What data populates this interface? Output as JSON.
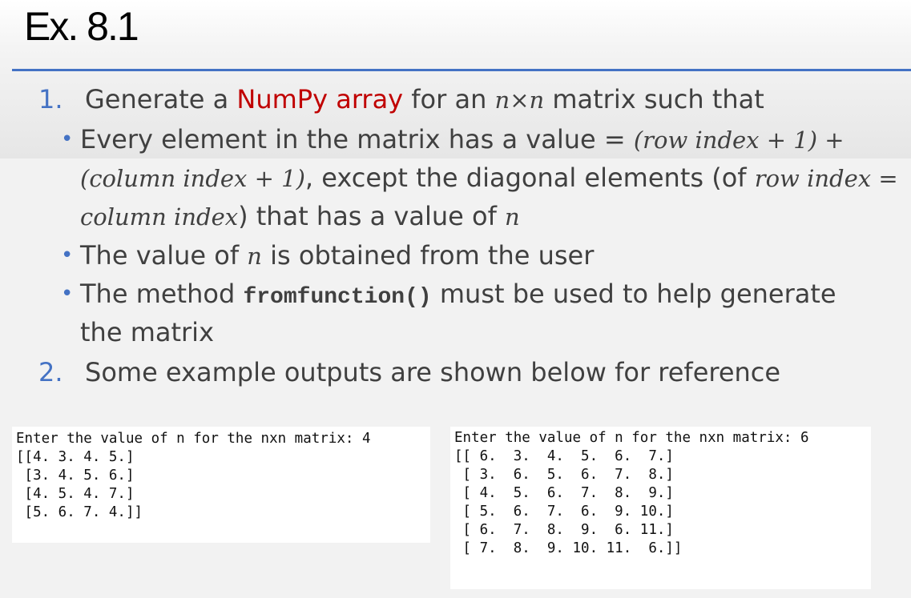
{
  "slide": {
    "title": "Ex. 8.1",
    "item1": {
      "num": "1.",
      "pre": "Generate a ",
      "highlight": "NumPy array",
      "mid": " for an ",
      "math": "n×n",
      "post": " matrix such that"
    },
    "bullet1": {
      "line1_pre": "Every element in the matrix has a value = ",
      "line1_math": "(row index + 1) +",
      "line2_math": "(column index + 1)",
      "line2_post": ", except the diagonal elements (of ",
      "line2_math2": "row index =",
      "line3_math": "column index",
      "line3_post": ") that has a value of ",
      "line3_n": "n"
    },
    "bullet2": {
      "pre": "The value of ",
      "n": "n",
      "post": " is obtained from the user"
    },
    "bullet3": {
      "pre": "The method ",
      "code": "fromfunction()",
      "post": " must be used to help generate",
      "line2": "the matrix"
    },
    "item2": {
      "num": "2.",
      "text": "Some example outputs are shown below for reference"
    }
  },
  "outputs": {
    "left": [
      "Enter the value of n for the nxn matrix: 4",
      "[[4. 3. 4. 5.]",
      " [3. 4. 5. 6.]",
      " [4. 5. 4. 7.]",
      " [5. 6. 7. 4.]]"
    ],
    "right": [
      "Enter the value of n for the nxn matrix: 6",
      "[[ 6.  3.  4.  5.  6.  7.]",
      " [ 3.  6.  5.  6.  7.  8.]",
      " [ 4.  5.  6.  7.  8.  9.]",
      " [ 5.  6.  7.  6.  9. 10.]",
      " [ 6.  7.  8.  9.  6. 11.]",
      " [ 7.  8.  9. 10. 11.  6.]]"
    ]
  },
  "colors": {
    "accent": "#4472c4",
    "highlight": "#c00000",
    "text": "#404040"
  }
}
